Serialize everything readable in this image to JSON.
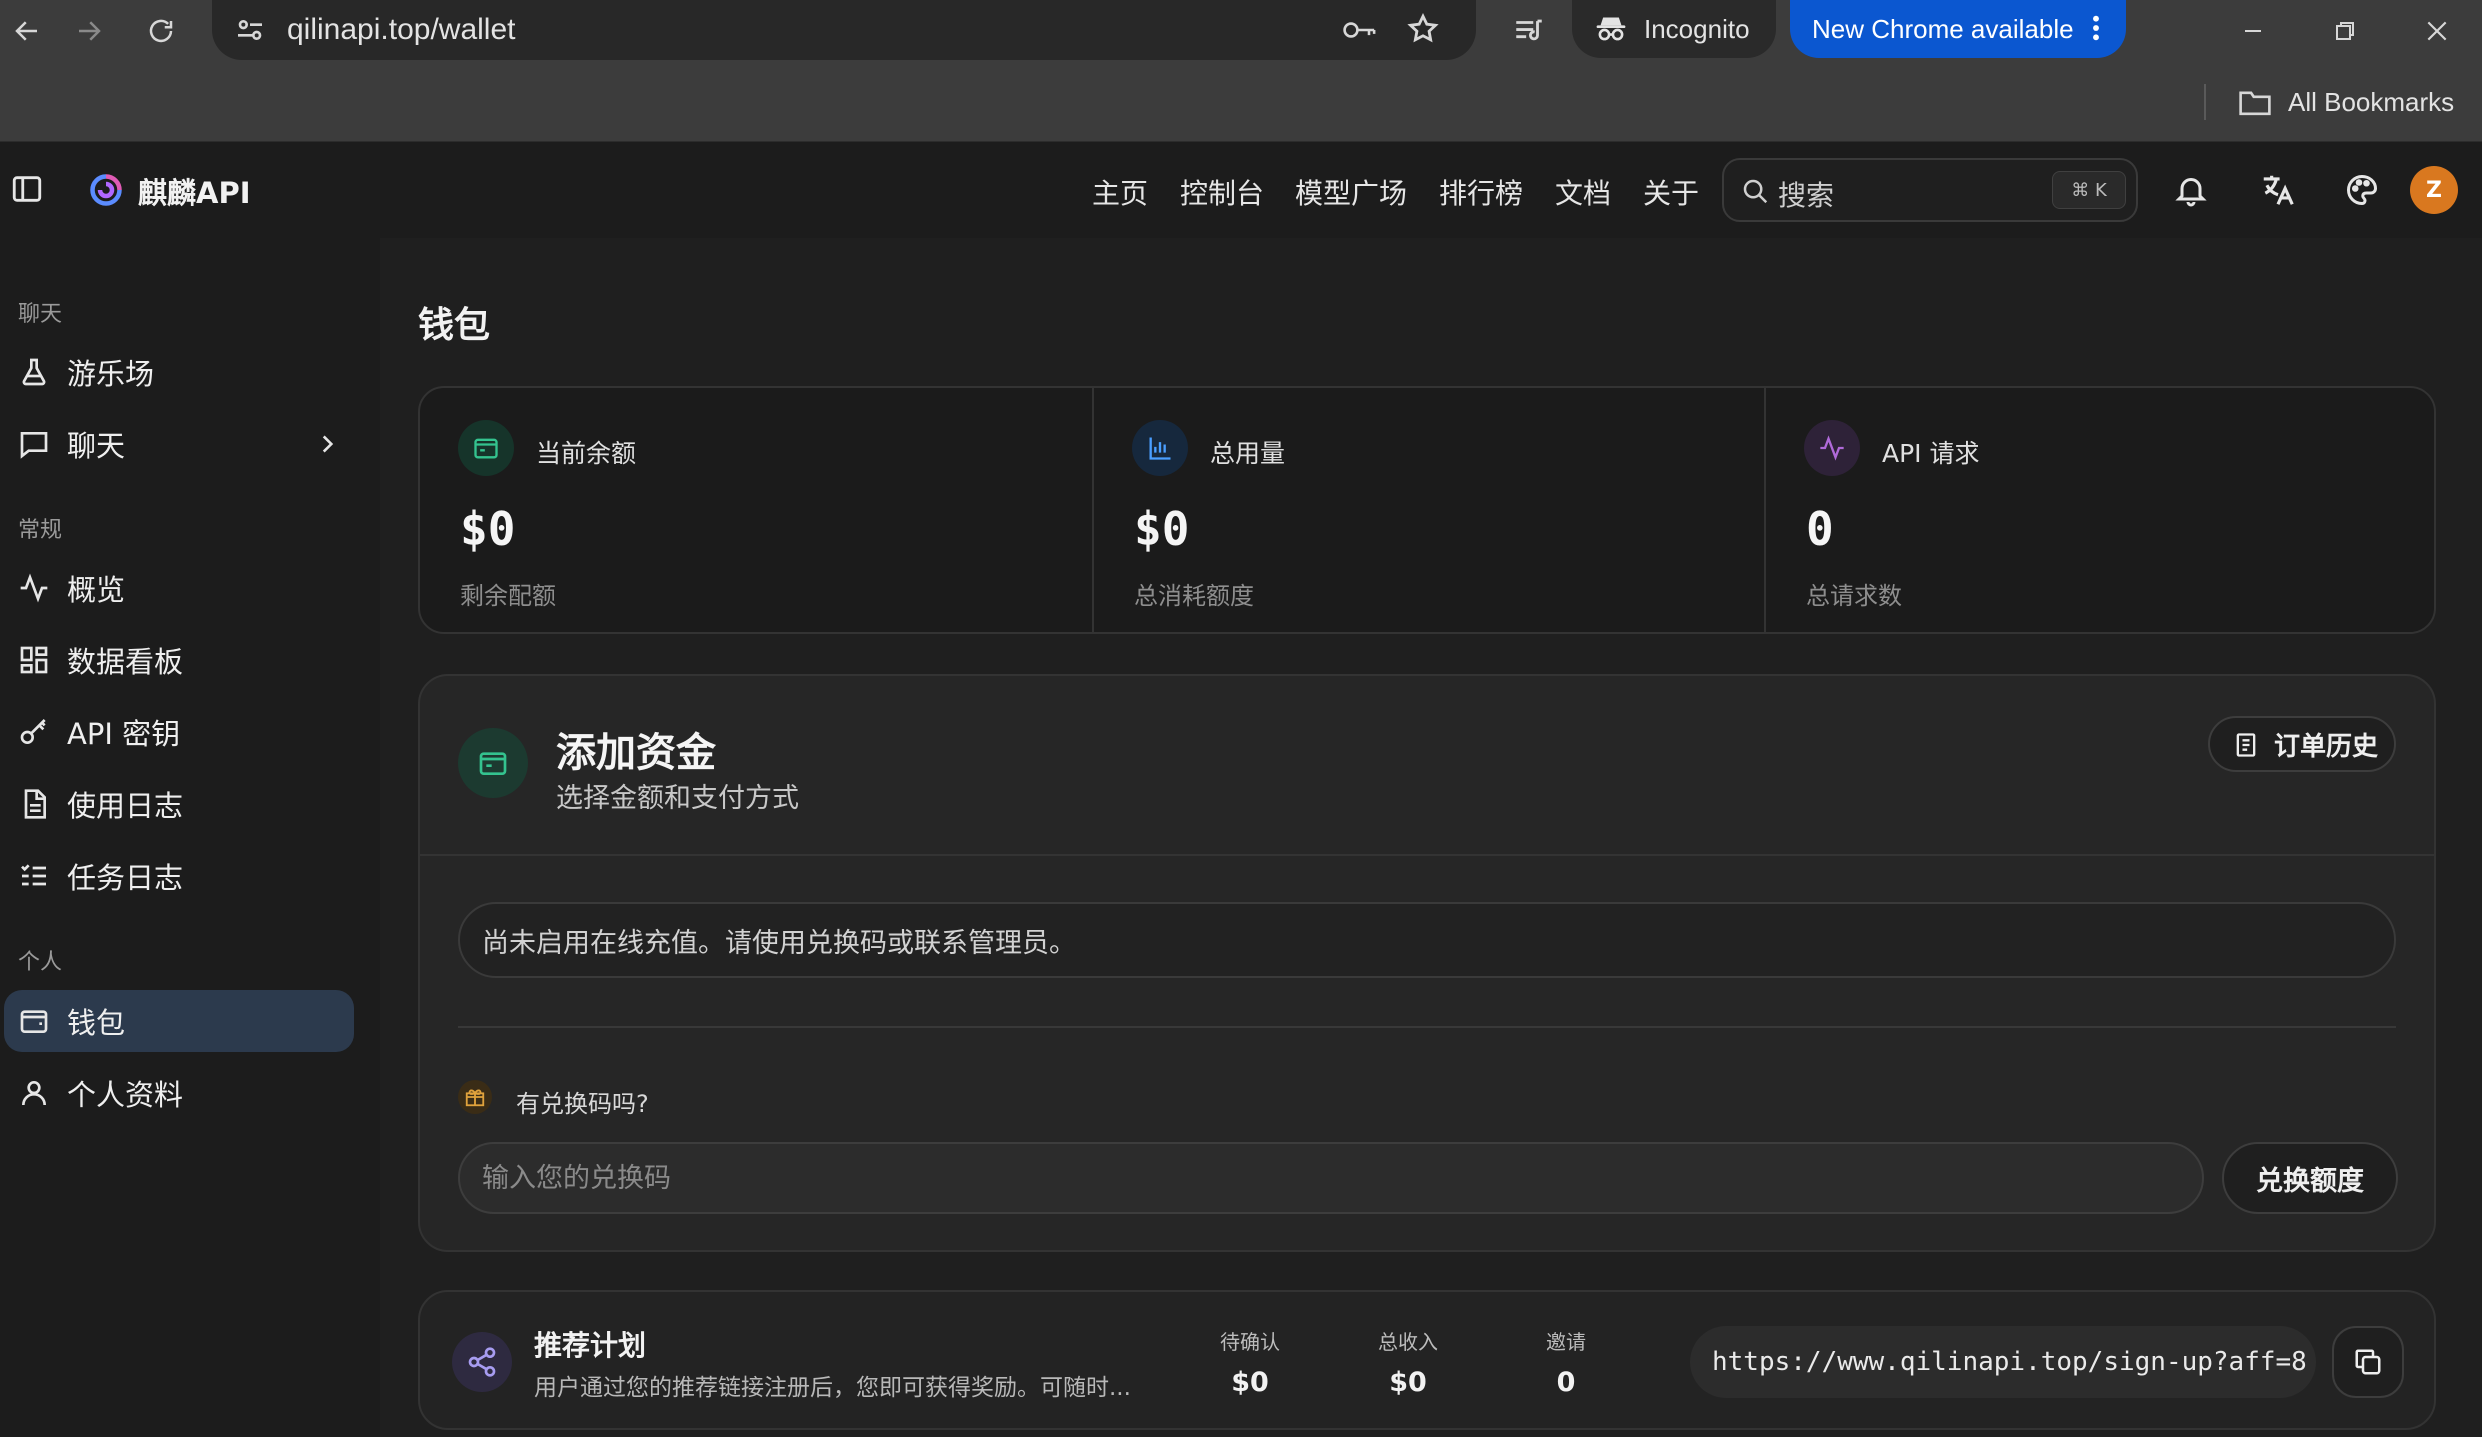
{
  "browser": {
    "url": "qilinapi.top/wallet",
    "incognito_label": "Incognito",
    "update_label": "New Chrome available",
    "bookmarks_label": "All Bookmarks"
  },
  "header": {
    "brand": "麒麟API",
    "nav": [
      "主页",
      "控制台",
      "模型广场",
      "排行榜",
      "文档",
      "关于"
    ],
    "search_placeholder": "搜索",
    "search_shortcut": "⌘ K",
    "avatar_letter": "Z"
  },
  "sidebar": {
    "sections": [
      {
        "title": "聊天",
        "items": [
          {
            "label": "游乐场",
            "icon": "flask-icon"
          },
          {
            "label": "聊天",
            "icon": "chat-icon",
            "expandable": true
          }
        ]
      },
      {
        "title": "常规",
        "items": [
          {
            "label": "概览",
            "icon": "activity-icon"
          },
          {
            "label": "数据看板",
            "icon": "grid-icon"
          },
          {
            "label": "API 密钥",
            "icon": "key-icon"
          },
          {
            "label": "使用日志",
            "icon": "document-icon"
          },
          {
            "label": "任务日志",
            "icon": "checklist-icon"
          }
        ]
      },
      {
        "title": "个人",
        "items": [
          {
            "label": "钱包",
            "icon": "wallet-icon",
            "active": true
          },
          {
            "label": "个人资料",
            "icon": "user-icon"
          }
        ]
      }
    ]
  },
  "main": {
    "title": "钱包",
    "stats": [
      {
        "name": "当前余额",
        "value": "$0",
        "sub": "剩余配额",
        "icon": "wallet-icon",
        "color": "#34c38f"
      },
      {
        "name": "总用量",
        "value": "$0",
        "sub": "总消耗额度",
        "icon": "bar-chart-icon",
        "color": "#4a9eff"
      },
      {
        "name": "API 请求",
        "value": "0",
        "sub": "总请求数",
        "icon": "activity-icon",
        "color": "#b06ad9"
      }
    ],
    "fund": {
      "title": "添加资金",
      "subtitle": "选择金额和支付方式",
      "order_history": "订单历史",
      "notice": "尚未启用在线充值。请使用兑换码或联系管理员。",
      "redeem_question": "有兑换码吗?",
      "redeem_placeholder": "输入您的兑换码",
      "redeem_button": "兑换额度"
    },
    "referral": {
      "title": "推荐计划",
      "description": "用户通过您的推荐链接注册后，您即可获得奖励。可随时...",
      "stats": [
        {
          "label": "待确认",
          "value": "$0"
        },
        {
          "label": "总收入",
          "value": "$0"
        },
        {
          "label": "邀请",
          "value": "0"
        }
      ],
      "link": "https://www.qilinapi.top/sign-up?aff=8"
    }
  }
}
